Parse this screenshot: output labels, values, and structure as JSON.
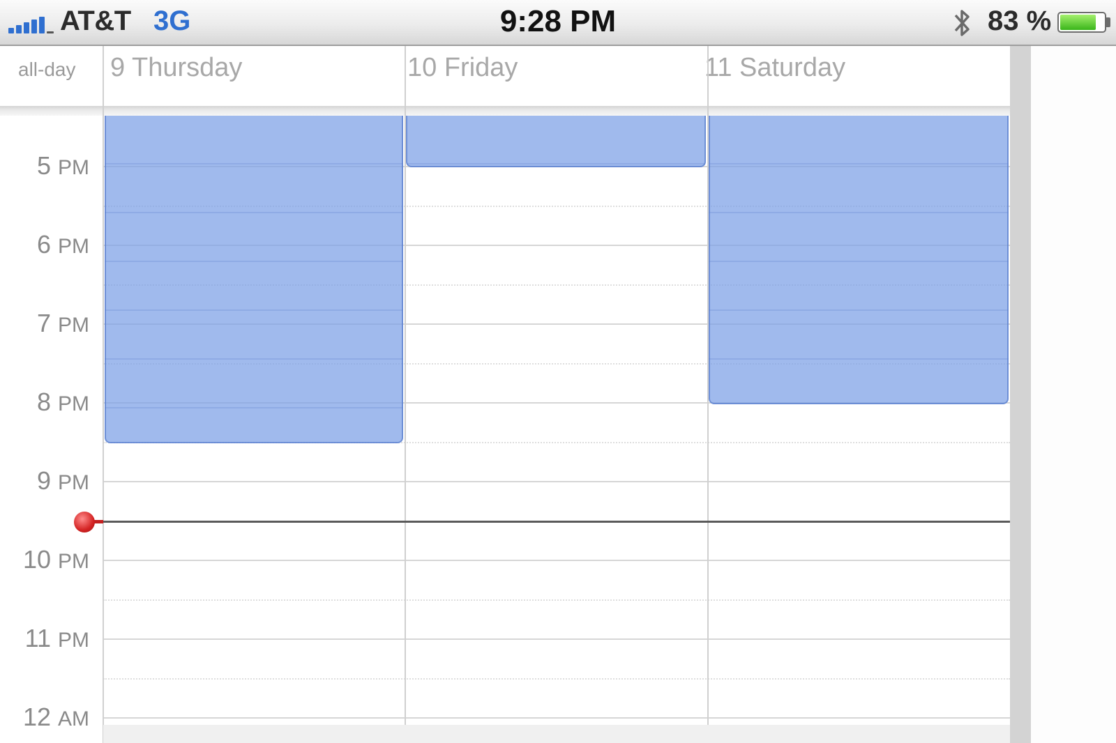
{
  "status_bar": {
    "carrier": "AT&T",
    "network": "3G",
    "time": "9:28 PM",
    "battery_percent": "83 %",
    "battery_level": 0.83,
    "signal_icon": "signal-bars-icon",
    "bluetooth_icon": "bluetooth-icon",
    "network_color": "#2f6fd0"
  },
  "calendar": {
    "all_day_label": "all-day",
    "days": [
      {
        "label": "9 Thursday"
      },
      {
        "label": "10 Friday"
      },
      {
        "label": "11 Saturday"
      }
    ],
    "hours": [
      {
        "num": "5",
        "ampm": "PM"
      },
      {
        "num": "6",
        "ampm": "PM"
      },
      {
        "num": "7",
        "ampm": "PM"
      },
      {
        "num": "8",
        "ampm": "PM"
      },
      {
        "num": "9",
        "ampm": "PM"
      },
      {
        "num": "10",
        "ampm": "PM"
      },
      {
        "num": "11",
        "ampm": "PM"
      },
      {
        "num": "12",
        "ampm": "AM"
      }
    ],
    "event_color": "#7ca0e6",
    "now_indicator_color": "#d42424"
  }
}
